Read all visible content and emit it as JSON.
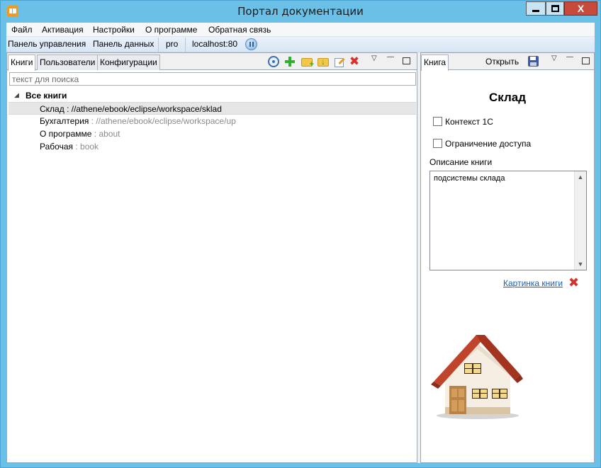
{
  "window": {
    "title": "Портал документации",
    "close_glyph": "X"
  },
  "menu": [
    "Файл",
    "Активация",
    "Настройки",
    "О программе",
    "Обратная связь"
  ],
  "toolbar": {
    "items": [
      "Панель управления",
      "Панель данных",
      "pro",
      "localhost:80"
    ],
    "pause_icon": "pause-icon"
  },
  "left_panel": {
    "tabs": [
      "Книги",
      "Пользователи",
      "Конфигурации"
    ],
    "active_tab": "Книги",
    "search_placeholder": "текст для поиска",
    "tool_icons": [
      "refresh-icon",
      "add-icon",
      "folder-add-icon",
      "folder-import-icon",
      "edit-icon",
      "delete-icon"
    ],
    "tree": {
      "root_label": "Все книги",
      "items": [
        {
          "name": "Склад",
          "separator": " : ",
          "path": "//athene/ebook/eclipse/workspace/sklad",
          "selected": true
        },
        {
          "name": "Бухгалтерия",
          "separator": " : ",
          "path": "//athene/ebook/eclipse/workspace/up",
          "selected": false
        },
        {
          "name": "О программе",
          "separator": " : ",
          "path": "about",
          "selected": false
        },
        {
          "name": "Рабочая",
          "separator": " : ",
          "path": "book",
          "selected": false
        }
      ]
    }
  },
  "right_panel": {
    "tab": "Книга",
    "open_label": "Открыть",
    "book_title": "Склад",
    "checkbox_context": "Контекст 1С",
    "checkbox_access": "Ограничение доступа",
    "description_label": "Описание книги",
    "description_text": "подсистемы склада",
    "picture_link": "Картинка книги",
    "picture_remove_glyph": "✖"
  },
  "colors": {
    "title_bar": "#6bc0e8",
    "close_button": "#c74a3c",
    "link": "#1a5fb4",
    "delete_red": "#d8302b",
    "add_green": "#2fae2f",
    "house_roof": "#c0442c"
  }
}
